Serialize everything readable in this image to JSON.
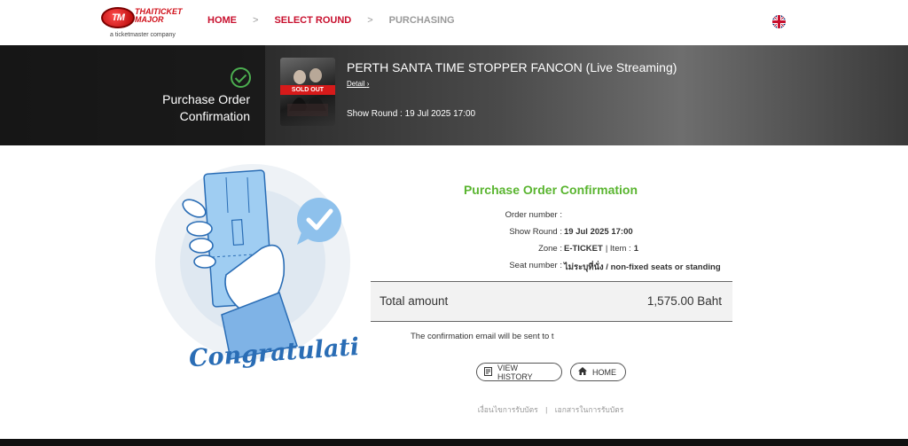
{
  "brand": {
    "badge": "TM",
    "name_line1": "THAITICKET",
    "name_line2": "MAJOR",
    "tagline": "a ticketmaster company"
  },
  "breadcrumb": [
    {
      "label": "HOME",
      "state": "active"
    },
    {
      "label": "SELECT ROUND",
      "state": "active"
    },
    {
      "label": "PURCHASING",
      "state": "inactive"
    }
  ],
  "breadcrumb_separator": ">",
  "language": {
    "icon": "uk-flag-icon"
  },
  "banner": {
    "status_title": "Purchase Order Confirmation",
    "poster_badge": "SOLD OUT",
    "event_title": "PERTH SANTA TIME STOPPER FANCON (Live Streaming)",
    "detail_link": "Detail",
    "show_round_label": "Show Round",
    "show_round_value": "19 Jul 2025 17:00"
  },
  "illustration": {
    "caption": "Congratulations"
  },
  "confirmation": {
    "title": "Purchase Order Confirmation",
    "rows": [
      {
        "label": "Order number :",
        "value": ""
      },
      {
        "label": "Show Round :",
        "value": "19 Jul 2025 17:00"
      },
      {
        "label": "Zone :",
        "value": "E-TICKET",
        "extra_label": "| Item :",
        "extra_value": "1"
      },
      {
        "label": "Seat number :",
        "value": "ไม่ระบุที่นั่ง / non-fixed seats or standing"
      }
    ],
    "total_label": "Total amount",
    "total_value": "1,575.00 Baht",
    "email_note": "The confirmation email will be sent to t"
  },
  "buttons": {
    "history": "VIEW HISTORY",
    "home": "HOME"
  },
  "footer": {
    "link1": "เงื่อนไขการรับบัตร",
    "separator": "|",
    "link2": "เอกสารในการรับบัตร"
  },
  "colors": {
    "accent": "#c8102e",
    "success": "#5ab530",
    "illustration_blue": "#2a6db5"
  }
}
